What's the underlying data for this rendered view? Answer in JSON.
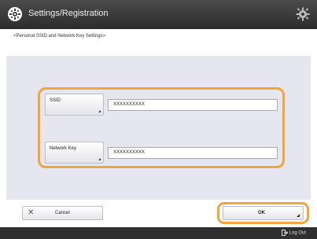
{
  "header": {
    "title": "Settings/Registration",
    "logo_icon": "gear-badge-icon",
    "settings_icon": "gear-icon"
  },
  "subtitle": "<Personal SSID and Network Key Settings>",
  "form": {
    "ssid_label": "SSID",
    "ssid_value": "XXXXXXXXXX",
    "key_label": "Network Key",
    "key_value": "XXXXXXXXXX"
  },
  "actions": {
    "cancel_label": "Cancel",
    "ok_label": "OK"
  },
  "footer": {
    "logout_label": "Log Out"
  },
  "colors": {
    "highlight": "#f2a63a",
    "panel": "#e6e6f0",
    "titlebar": "#3a3a3a"
  }
}
